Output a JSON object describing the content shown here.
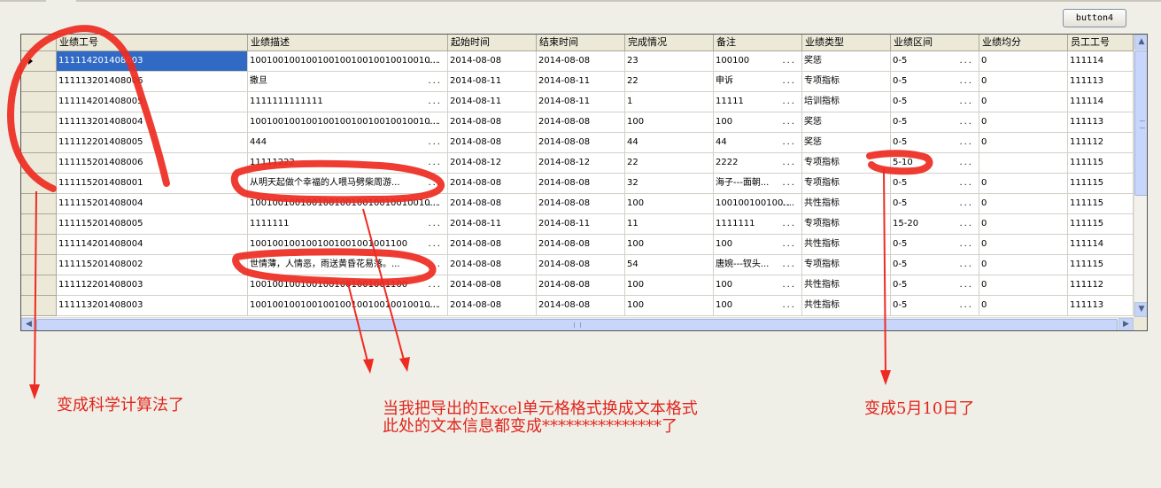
{
  "toolbar": {
    "button4_label": "button4"
  },
  "columns": [
    {
      "key": "emp_id",
      "label": "业绩工号"
    },
    {
      "key": "desc",
      "label": "业绩描述"
    },
    {
      "key": "start",
      "label": "起始时间"
    },
    {
      "key": "end",
      "label": "结束时间"
    },
    {
      "key": "done",
      "label": "完成情况"
    },
    {
      "key": "note",
      "label": "备注"
    },
    {
      "key": "type",
      "label": "业绩类型"
    },
    {
      "key": "range",
      "label": "业绩区间"
    },
    {
      "key": "avg",
      "label": "业绩均分"
    },
    {
      "key": "staff",
      "label": "员工工号"
    }
  ],
  "rows": [
    {
      "emp_id": "111114201408003",
      "desc": "10010010010010010010010010010010...",
      "start": "2014-08-08",
      "end": "2014-08-08",
      "done": "23",
      "note": "100100",
      "type": "奖惩",
      "range": "0-5",
      "avg": "0",
      "staff": "111114"
    },
    {
      "emp_id": "111113201408006",
      "desc": "撒旦",
      "start": "2014-08-11",
      "end": "2014-08-11",
      "done": "22",
      "note": "申诉",
      "type": "专项指标",
      "range": "0-5",
      "avg": "0",
      "staff": "111113"
    },
    {
      "emp_id": "111114201408005",
      "desc": "1111111111111",
      "start": "2014-08-11",
      "end": "2014-08-11",
      "done": "1",
      "note": "11111",
      "type": "培训指标",
      "range": "0-5",
      "avg": "0",
      "staff": "111114"
    },
    {
      "emp_id": "111113201408004",
      "desc": "10010010010010010010010010010010...",
      "start": "2014-08-08",
      "end": "2014-08-08",
      "done": "100",
      "note": "100",
      "type": "奖惩",
      "range": "0-5",
      "avg": "0",
      "staff": "111113"
    },
    {
      "emp_id": "111112201408005",
      "desc": "444",
      "start": "2014-08-08",
      "end": "2014-08-08",
      "done": "44",
      "note": "44",
      "type": "奖惩",
      "range": "0-5",
      "avg": "0",
      "staff": "111112"
    },
    {
      "emp_id": "111115201408006",
      "desc": "11111222",
      "start": "2014-08-12",
      "end": "2014-08-12",
      "done": "22",
      "note": "2222",
      "type": "专项指标",
      "range": "5-10",
      "avg": "",
      "staff": "111115"
    },
    {
      "emp_id": "111115201408001",
      "desc": "从明天起做个幸福的人喂马劈柴周游...",
      "start": "2014-08-08",
      "end": "2014-08-08",
      "done": "32",
      "note": "海子---面朝...",
      "type": "专项指标",
      "range": "0-5",
      "avg": "0",
      "staff": "111115"
    },
    {
      "emp_id": "111115201408004",
      "desc": "10010010010010010010010010010010...",
      "start": "2014-08-08",
      "end": "2014-08-08",
      "done": "100",
      "note": "100100100100...",
      "type": "共性指标",
      "range": "0-5",
      "avg": "0",
      "staff": "111115"
    },
    {
      "emp_id": "111115201408005",
      "desc": "1111111",
      "start": "2014-08-11",
      "end": "2014-08-11",
      "done": "11",
      "note": "1111111",
      "type": "专项指标",
      "range": "15-20",
      "avg": "0",
      "staff": "111115"
    },
    {
      "emp_id": "111114201408004",
      "desc": "1001001001001001001001001100",
      "start": "2014-08-08",
      "end": "2014-08-08",
      "done": "100",
      "note": "100",
      "type": "共性指标",
      "range": "0-5",
      "avg": "0",
      "staff": "111114"
    },
    {
      "emp_id": "111115201408002",
      "desc": "世情薄，人情恶，雨送黄昏花易落。...",
      "start": "2014-08-08",
      "end": "2014-08-08",
      "done": "54",
      "note": "唐婉---钗头...",
      "type": "专项指标",
      "range": "0-5",
      "avg": "0",
      "staff": "111115"
    },
    {
      "emp_id": "111112201408003",
      "desc": "1001001001001001001001001100",
      "start": "2014-08-08",
      "end": "2014-08-08",
      "done": "100",
      "note": "100",
      "type": "共性指标",
      "range": "0-5",
      "avg": "0",
      "staff": "111112"
    },
    {
      "emp_id": "111113201408003",
      "desc": "10010010010010010010010010010010...",
      "start": "2014-08-08",
      "end": "2014-08-08",
      "done": "100",
      "note": "100",
      "type": "共性指标",
      "range": "0-5",
      "avg": "0",
      "staff": "111113"
    }
  ],
  "annotations": {
    "left": "变成科学计算法了",
    "middle_line1": "当我把导出的Excel单元格格式换成文本格式",
    "middle_line2": "此处的文本信息都变成***************了",
    "right": "变成5月10日了"
  },
  "colors": {
    "annotation": "#e0251d",
    "selection": "#316ac5"
  }
}
